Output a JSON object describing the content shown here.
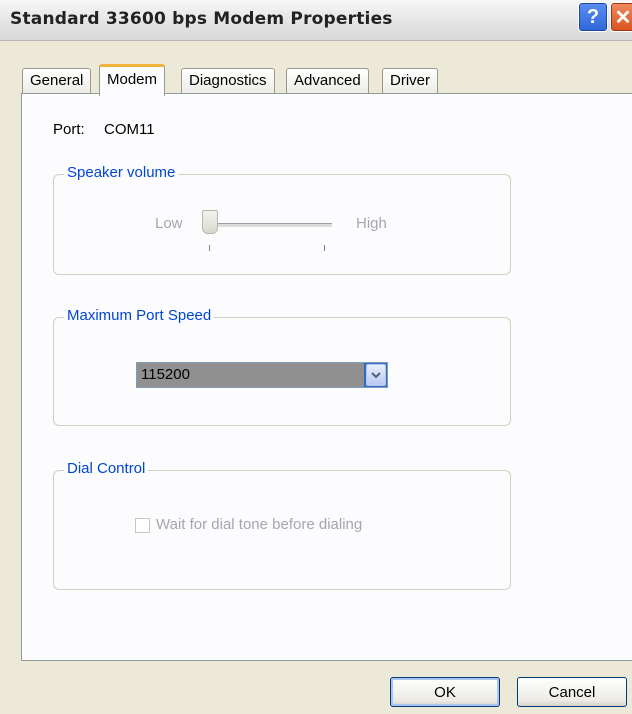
{
  "window": {
    "title": "Standard 33600 bps Modem Properties",
    "help_glyph": "?",
    "close_glyph": "✕"
  },
  "tabs": [
    {
      "label": "General",
      "active": false
    },
    {
      "label": "Modem",
      "active": true
    },
    {
      "label": "Diagnostics",
      "active": false
    },
    {
      "label": "Advanced",
      "active": false
    },
    {
      "label": "Driver",
      "active": false
    }
  ],
  "port": {
    "label": "Port:",
    "value": "COM11"
  },
  "speaker_volume": {
    "legend": "Speaker volume",
    "low_label": "Low",
    "high_label": "High",
    "level": 0.0,
    "enabled": false
  },
  "max_port_speed": {
    "legend": "Maximum Port Speed",
    "selected": "115200"
  },
  "dial_control": {
    "legend": "Dial Control",
    "checkbox_label": "Wait for dial tone before dialing",
    "checked": false,
    "enabled": false
  },
  "buttons": {
    "ok": "OK",
    "cancel": "Cancel"
  },
  "colors": {
    "dialog_bg": "#ece9d8",
    "group_legend": "#0046d5",
    "active_tab_highlight": "#f2b33d",
    "disabled_text": "#a7a6aa"
  },
  "icons": {
    "help": "help-icon",
    "close": "close-icon",
    "dropdown": "chevron-down-icon"
  }
}
